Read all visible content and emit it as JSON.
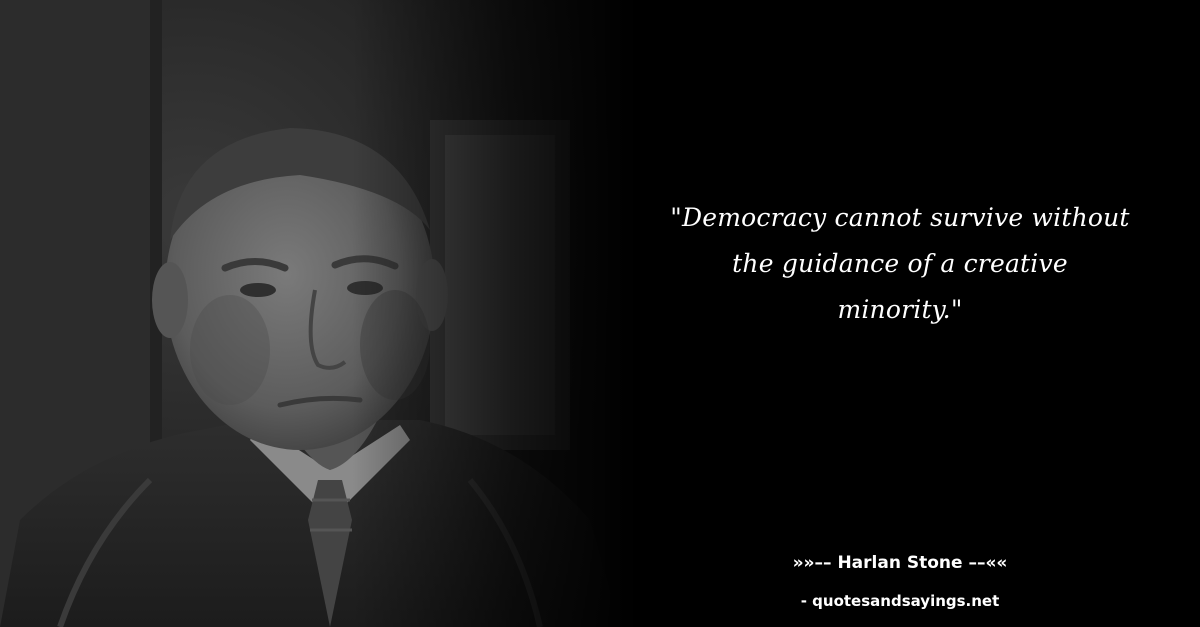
{
  "quote": {
    "lines": [
      "\"Democracy cannot survive without",
      "the guidance of a creative",
      "minority.\""
    ]
  },
  "author": {
    "text": "»»–– Harlan Stone ––««"
  },
  "source": {
    "text": "- quotesandsayings.net"
  },
  "colors": {
    "background": "#000000",
    "text": "#ffffff"
  },
  "icons": {
    "portrait": "man-portrait-photo"
  }
}
